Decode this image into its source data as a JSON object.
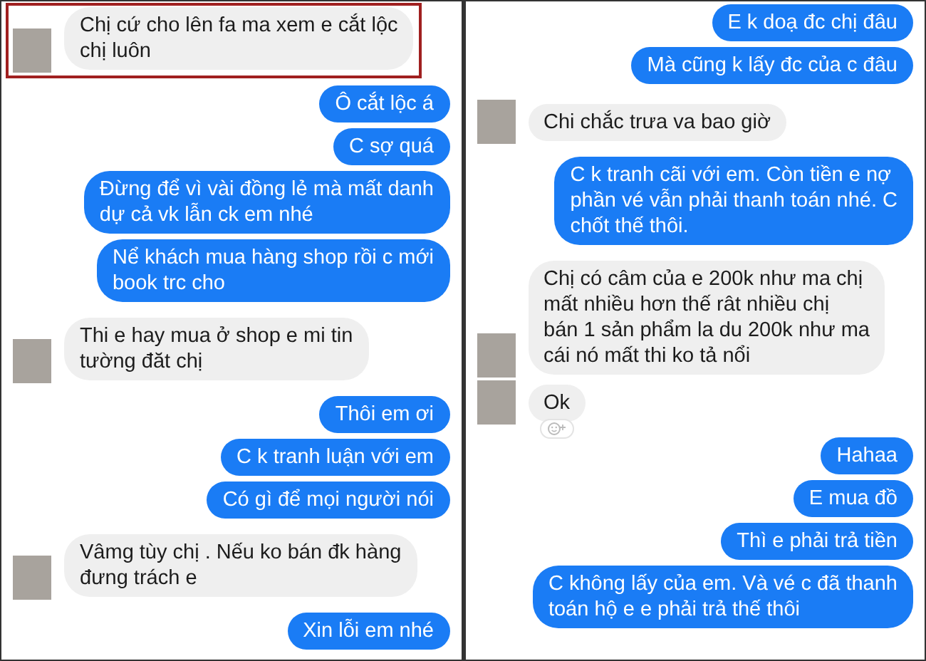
{
  "panels": [
    {
      "messages": [
        {
          "kind": "received",
          "text": "Chị cứ cho lên fa ma xem e cắt lộc\nchị luôn",
          "highlighted": true
        },
        {
          "kind": "sent",
          "text": "Ô cắt lộc á"
        },
        {
          "kind": "sent",
          "text": "C sợ quá"
        },
        {
          "kind": "sent",
          "text": "Đừng để vì vài đồng lẻ mà mất danh\ndự cả vk lẫn ck em nhé"
        },
        {
          "kind": "sent",
          "text": "Nể khách mua hàng shop rồi c mới\nbook trc cho"
        },
        {
          "kind": "received",
          "text": "Thi e hay mua ở shop e mi tin\ntường đăt chị"
        },
        {
          "kind": "sent",
          "text": "Thôi em ơi"
        },
        {
          "kind": "sent",
          "text": "C k tranh luận với em"
        },
        {
          "kind": "sent",
          "text": "Có gì để mọi người nói"
        },
        {
          "kind": "received",
          "text": "Vâmg tùy chị .  Nếu ko bán đk hàng\nđưng trách e"
        },
        {
          "kind": "sent",
          "text": "Xin lỗi em nhé"
        }
      ]
    },
    {
      "messages": [
        {
          "kind": "sent",
          "text": "E k doạ đc chị đâu"
        },
        {
          "kind": "sent",
          "text": "Mà cũng k lấy đc của c đâu"
        },
        {
          "kind": "received",
          "text": "Chi chắc trưa va bao giờ"
        },
        {
          "kind": "sent",
          "text": "C k tranh cãi với em. Còn tiền e nợ\nphần vé vẫn phải thanh toán nhé. C\nchốt thế thôi."
        },
        {
          "kind": "received",
          "text": "Chị có câm của e 200k như ma chị\nmất nhiều hơn thế rât nhiều  chị\nbán 1 sản phẩm la du 200k như ma\ncái nó mất thi ko tả nổi"
        },
        {
          "kind": "received",
          "text": "Ok",
          "reaction": true
        },
        {
          "kind": "sent",
          "text": "Hahaa"
        },
        {
          "kind": "sent",
          "text": "E mua đồ"
        },
        {
          "kind": "sent",
          "text": "Thì e phải trả tiền"
        },
        {
          "kind": "sent",
          "text": "C không lấy của em. Và vé c đã thanh\ntoán hộ e e phải trả thế thôi"
        }
      ]
    }
  ]
}
